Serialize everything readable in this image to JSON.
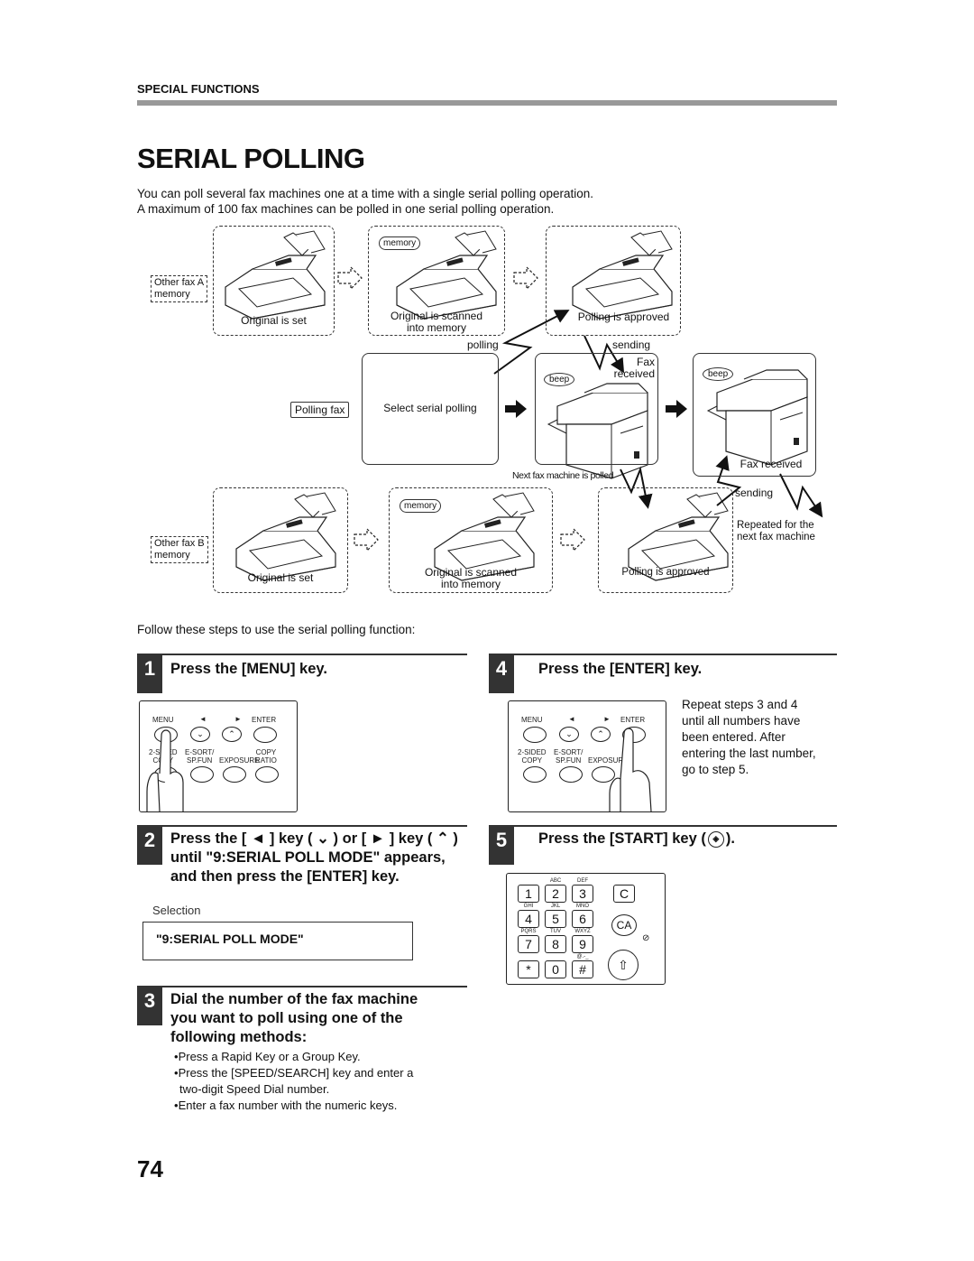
{
  "header": {
    "section": "SPECIAL FUNCTIONS",
    "title": "SERIAL POLLING",
    "intro": [
      "You can poll several fax machines one at a time with a single serial polling operation.",
      "A maximum of 100 fax machines can be polled in one serial polling operation."
    ]
  },
  "diagram": {
    "other_fax_a": [
      "Other fax A",
      "memory"
    ],
    "other_fax_b": [
      "Other fax B",
      "memory"
    ],
    "original_is_set": "Original is set",
    "original_scanned": [
      "Original is scanned",
      "into memory"
    ],
    "polling_approved": "Polling is approved",
    "memory_bubble": "memory",
    "polling": "polling",
    "sending": "sending",
    "fax_received_top": [
      "Fax",
      "received"
    ],
    "fax_received": "Fax received",
    "polling_fax": "Polling fax",
    "select_serial_polling": "Select serial polling",
    "beep": "beep",
    "next_fax_polled": "Next fax machine is polled",
    "repeated": [
      "Repeated for the",
      "next fax machine"
    ]
  },
  "steps_intro": "Follow these steps to use the serial polling function:",
  "panel_labels": {
    "menu": "MENU",
    "left": "◄",
    "right": "►",
    "enter": "ENTER",
    "two_sided": [
      "2-SIDED",
      "COPY"
    ],
    "esort": [
      "E-SORT/",
      "SP.FUN"
    ],
    "exposure": "EXPOSURE",
    "copy_ratio": [
      "COPY",
      "RATIO"
    ]
  },
  "steps": [
    {
      "number": "1",
      "title": "Press the [MENU] key."
    },
    {
      "number": "2",
      "title_lines": [
        "Press the [ ◄ ] key ( ⌄ ) or [ ► ] key ( ⌃ )",
        "until \"9:SERIAL POLL MODE\" appears,",
        "and then press the [ENTER] key."
      ],
      "selection_label": "Selection",
      "selection_value": "\"9:SERIAL POLL MODE\""
    },
    {
      "number": "3",
      "title_lines": [
        "Dial the number of the fax machine",
        "you want to poll using one of the",
        "following methods:"
      ],
      "bullets": [
        "Press a Rapid Key or a Group Key.",
        "Press the [SPEED/SEARCH] key and enter a",
        "two-digit Speed Dial number.",
        "Enter a fax number with the numeric keys."
      ]
    },
    {
      "number": "4",
      "title": "Press the [ENTER] key.",
      "note": [
        "Repeat steps 3 and 4",
        "until all numbers have",
        "been entered. After",
        "entering the last number,",
        "go to step 5."
      ]
    },
    {
      "number": "5",
      "title": "Press the  [START] key (",
      "title_end": ")."
    }
  ],
  "keypad": {
    "keys": [
      "1",
      "2",
      "3",
      "4",
      "5",
      "6",
      "7",
      "8",
      "9",
      "*",
      "0",
      "#"
    ],
    "subs": [
      "",
      "ABC",
      "DEF",
      "GHI",
      "JKL",
      "MNO",
      "PQRS",
      "TUV",
      "WXYZ",
      "",
      "",
      "@.-_"
    ],
    "c": "C",
    "ca": "CA"
  },
  "page_number": "74"
}
